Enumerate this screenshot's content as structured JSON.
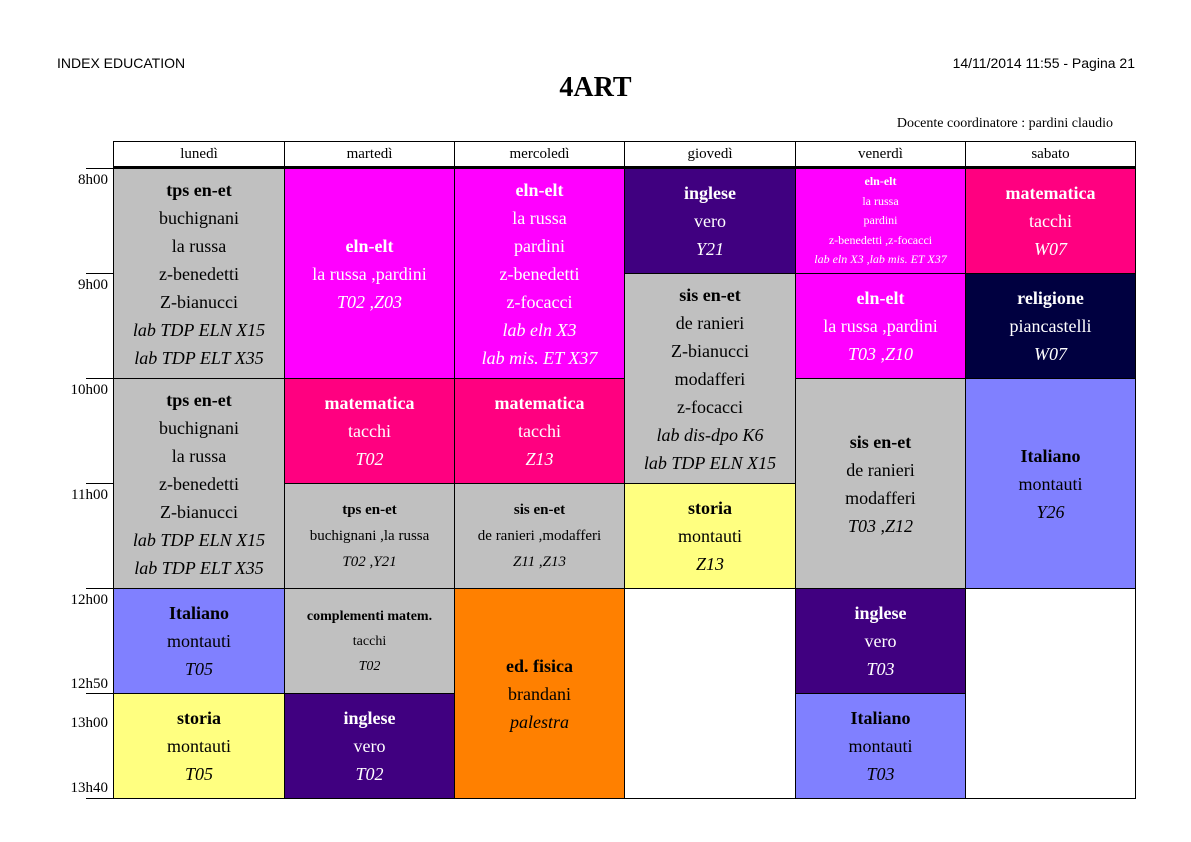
{
  "header": {
    "left": "INDEX EDUCATION",
    "right": "14/11/2014 11:55 - Pagina 21",
    "title": "4ART",
    "coordinator": "Docente coordinatore : pardini claudio"
  },
  "days": [
    "lunedì",
    "martedì",
    "mercoledì",
    "giovedì",
    "venerdì",
    "sabato"
  ],
  "times": [
    "8h00",
    "9h00",
    "10h00",
    "11h00",
    "12h00",
    "12h50",
    "13h00",
    "13h40"
  ],
  "colors": {
    "grey": "#c0c0c0",
    "magenta": "#ff00ff",
    "pink": "#ff0080",
    "purple": "#400080",
    "navy": "#000040",
    "periwinkle": "#8080ff",
    "yellow": "#ffff80",
    "orange": "#ff8000"
  },
  "cells": {
    "mon1": [
      "tps en-et",
      "buchignani",
      "la russa",
      "z-benedetti",
      "Z-bianucci",
      "lab TDP ELN X15",
      "lab TDP ELT X35"
    ],
    "mon2": [
      "tps en-et",
      "buchignani",
      "la russa",
      "z-benedetti",
      "Z-bianucci",
      "lab TDP ELN X15",
      "lab TDP ELT X35"
    ],
    "mon3": [
      "Italiano",
      "montauti",
      "T05"
    ],
    "mon4": [
      "storia",
      "montauti",
      "T05"
    ],
    "tue1": [
      "eln-elt",
      "la russa  ,pardini",
      "T02 ,Z03"
    ],
    "tue2": [
      "matematica",
      "tacchi",
      "T02"
    ],
    "tue3": [
      "tps en-et",
      "buchignani  ,la russa",
      "T02 ,Y21"
    ],
    "tue4": [
      "complementi matem.",
      "tacchi",
      "T02"
    ],
    "tue5": [
      "inglese",
      "vero",
      "T02"
    ],
    "wed1": [
      "eln-elt",
      "la russa",
      "pardini",
      "z-benedetti",
      "z-focacci",
      "lab eln X3",
      "lab mis. ET X37"
    ],
    "wed2": [
      "matematica",
      "tacchi",
      "Z13"
    ],
    "wed3": [
      "sis en-et",
      "de ranieri  ,modafferi",
      "Z11 ,Z13"
    ],
    "wed4": [
      "ed. fisica",
      "brandani",
      "palestra"
    ],
    "thu1": [
      "inglese",
      "vero",
      "Y21"
    ],
    "thu2": [
      "sis en-et",
      "de ranieri",
      "Z-bianucci",
      "modafferi",
      "z-focacci",
      "lab dis-dpo K6",
      "lab TDP ELN X15"
    ],
    "thu3": [
      "storia",
      "montauti",
      "Z13"
    ],
    "fri1": [
      "eln-elt",
      "la russa",
      "pardini",
      "z-benedetti  ,z-focacci",
      "lab eln X3  ,lab mis. ET X37"
    ],
    "fri2": [
      "eln-elt",
      "la russa  ,pardini",
      "T03 ,Z10"
    ],
    "fri3": [
      "sis en-et",
      "de ranieri",
      "modafferi",
      "T03 ,Z12"
    ],
    "fri4": [
      "inglese",
      "vero",
      "T03"
    ],
    "fri5": [
      "Italiano",
      "montauti",
      "T03"
    ],
    "sat1": [
      "matematica",
      "tacchi",
      "W07"
    ],
    "sat2": [
      "religione",
      "piancastelli",
      "W07"
    ],
    "sat3": [
      "Italiano",
      "montauti",
      "Y26"
    ]
  }
}
